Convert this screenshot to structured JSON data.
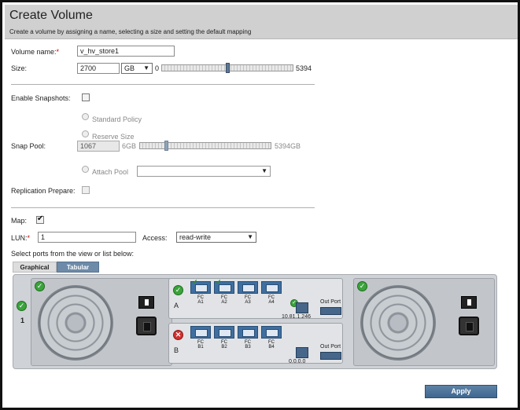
{
  "header": {
    "title": "Create Volume",
    "subtitle": "Create a volume by assigning a name, selecting a size and setting the default mapping"
  },
  "volume": {
    "name_label": "Volume name:",
    "required_mark": "*",
    "name_value": "v_hv_store1",
    "size_label": "Size:",
    "size_value": "2700",
    "size_unit": "GB",
    "slider_min": "0",
    "slider_max": "5394",
    "slider_fraction": 0.5
  },
  "snapshots": {
    "enable_label": "Enable Snapshots:",
    "enabled": false,
    "standard_policy_label": "Standard Policy",
    "reserve_size_label": "Reserve Size",
    "snap_pool_label": "Snap Pool:",
    "reserve_value": "1067",
    "slider_min": "6GB",
    "slider_max": "5394GB",
    "slider_fraction": 0.2,
    "attach_pool_label": "Attach Pool",
    "replication_label": "Replication Prepare:"
  },
  "mapping": {
    "map_label": "Map:",
    "map_checked": true,
    "lun_label": "LUN:",
    "lun_required_mark": "*",
    "lun_value": "1",
    "access_label": "Access:",
    "access_value": "read-write",
    "select_ports_text": "Select ports from the view or list below:"
  },
  "tabs": {
    "graphical": "Graphical",
    "tabular": "Tabular"
  },
  "enclosure": {
    "number": "1",
    "controller_a": {
      "id": "A",
      "ports": [
        "FC\nA1",
        "FC\nA2",
        "FC\nA3",
        "FC\nA4"
      ],
      "ip": "10.81.1.246",
      "out_port_label": "Out Port"
    },
    "controller_b": {
      "id": "B",
      "ports": [
        "FC\nB1",
        "FC\nB2",
        "FC\nB3",
        "FC\nB4"
      ],
      "ip": "0.0.0.0",
      "out_port_label": "Out Port"
    }
  },
  "apply_label": "Apply",
  "colors": {
    "header_bg": "#d0d0d0",
    "button_blue": "#4a6f96",
    "ok_green": "#3aa43a",
    "error_red": "#d13030"
  }
}
